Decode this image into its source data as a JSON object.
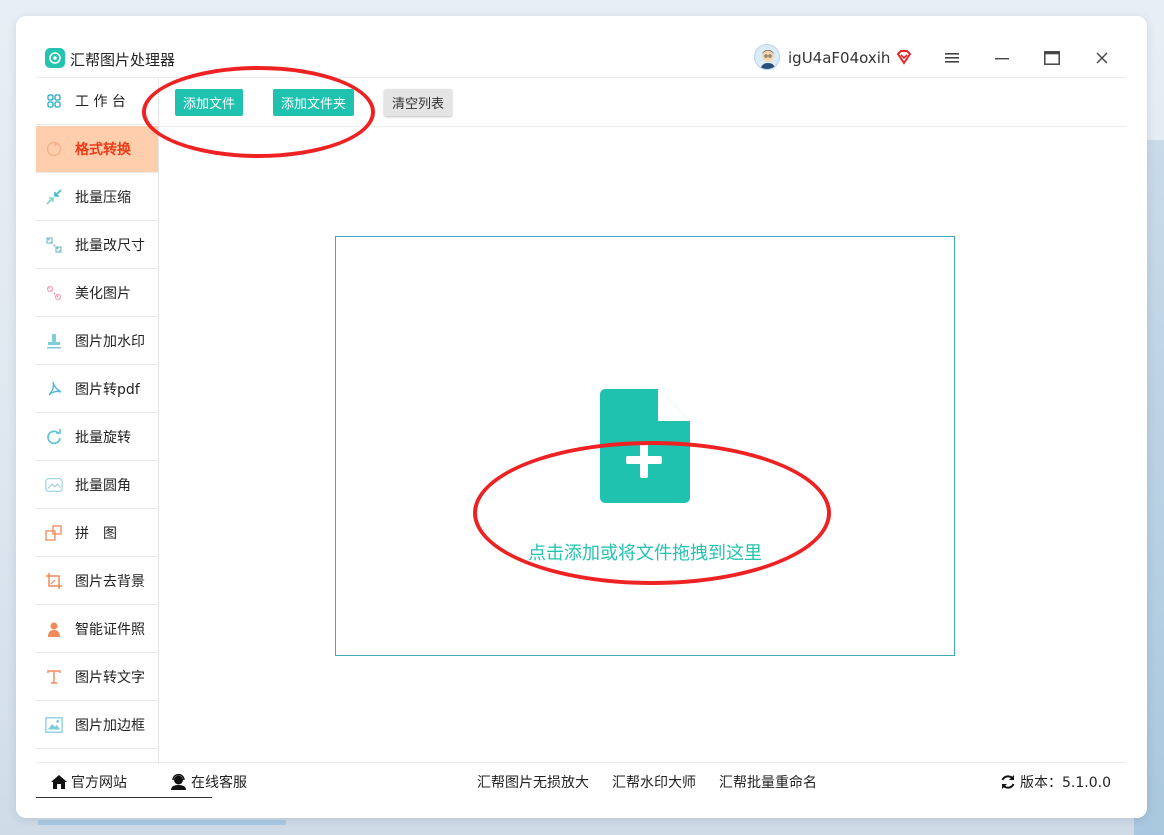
{
  "app": {
    "title": "汇帮图片处理器",
    "username": "igU4aF04oxih"
  },
  "sidebar": {
    "items": [
      {
        "label": "工 作 台",
        "icon": "grid-icon",
        "active": false
      },
      {
        "label": "格式转换",
        "icon": "convert-icon",
        "active": true
      },
      {
        "label": "批量压缩",
        "icon": "compress-icon",
        "active": false
      },
      {
        "label": "批量改尺寸",
        "icon": "resize-icon",
        "active": false
      },
      {
        "label": "美化图片",
        "icon": "beautify-icon",
        "active": false
      },
      {
        "label": "图片加水印",
        "icon": "stamp-icon",
        "active": false
      },
      {
        "label": "图片转pdf",
        "icon": "pdf-icon",
        "active": false
      },
      {
        "label": "批量旋转",
        "icon": "rotate-icon",
        "active": false
      },
      {
        "label": "批量圆角",
        "icon": "rounded-corner-icon",
        "active": false
      },
      {
        "label": "拼　图",
        "icon": "puzzle-icon",
        "active": false
      },
      {
        "label": "图片去背景",
        "icon": "crop-icon",
        "active": false
      },
      {
        "label": "智能证件照",
        "icon": "person-icon",
        "active": false
      },
      {
        "label": "图片转文字",
        "icon": "text-icon",
        "active": false
      },
      {
        "label": "图片加边框",
        "icon": "frame-icon",
        "active": false
      }
    ]
  },
  "toolbar": {
    "add_file": "添加文件",
    "add_folder": "添加文件夹",
    "clear_list": "清空列表"
  },
  "dropzone": {
    "hint": "点击添加或将文件拖拽到这里"
  },
  "footer": {
    "official_site": "官方网站",
    "online_service": "在线客服",
    "link1": "汇帮图片无损放大",
    "link2": "汇帮水印大师",
    "link3": "汇帮批量重命名",
    "version": "版本：5.1.0.0"
  },
  "colors": {
    "accent": "#1fc2ae",
    "active_bg": "#ffcfad",
    "active_text": "#f03a17",
    "annotation": "#ee2222"
  }
}
